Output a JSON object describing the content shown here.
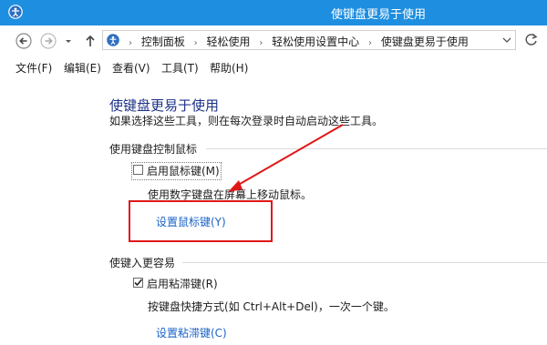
{
  "window": {
    "title": "使键盘更易于使用"
  },
  "address": {
    "crumbs": [
      "控制面板",
      "轻松使用",
      "轻松使用设置中心",
      "使键盘更易于使用"
    ]
  },
  "menu": [
    "文件(F)",
    "编辑(E)",
    "查看(V)",
    "工具(T)",
    "帮助(H)"
  ],
  "page": {
    "title": "使键盘更易于使用",
    "subtitle": "如果选择这些工具，则在每次登录时自动启动这些工具。"
  },
  "mouse_section": {
    "heading": "使用键盘控制鼠标",
    "checkbox_label": "启用鼠标键(M)",
    "checked": false,
    "description": "使用数字键盘在屏幕上移动鼠标。",
    "link": "设置鼠标键(Y)"
  },
  "sticky_section": {
    "heading": "使键入更容易",
    "checkbox_label": "启用粘滞键(R)",
    "checked": true,
    "description": "按键盘快捷方式(如 Ctrl+Alt+Del)，一次一个键。",
    "link": "设置粘滞键(C)"
  },
  "colors": {
    "titlebar": "#1e8fe0",
    "title_text": "#1e3287",
    "link": "#1a63c8",
    "annotation": "#e01818"
  },
  "icons": {
    "app": "ease-of-access-icon",
    "back": "back-arrow-icon",
    "forward": "forward-arrow-icon",
    "recent": "chevron-down-icon",
    "up": "up-arrow-icon",
    "refresh": "refresh-icon"
  }
}
